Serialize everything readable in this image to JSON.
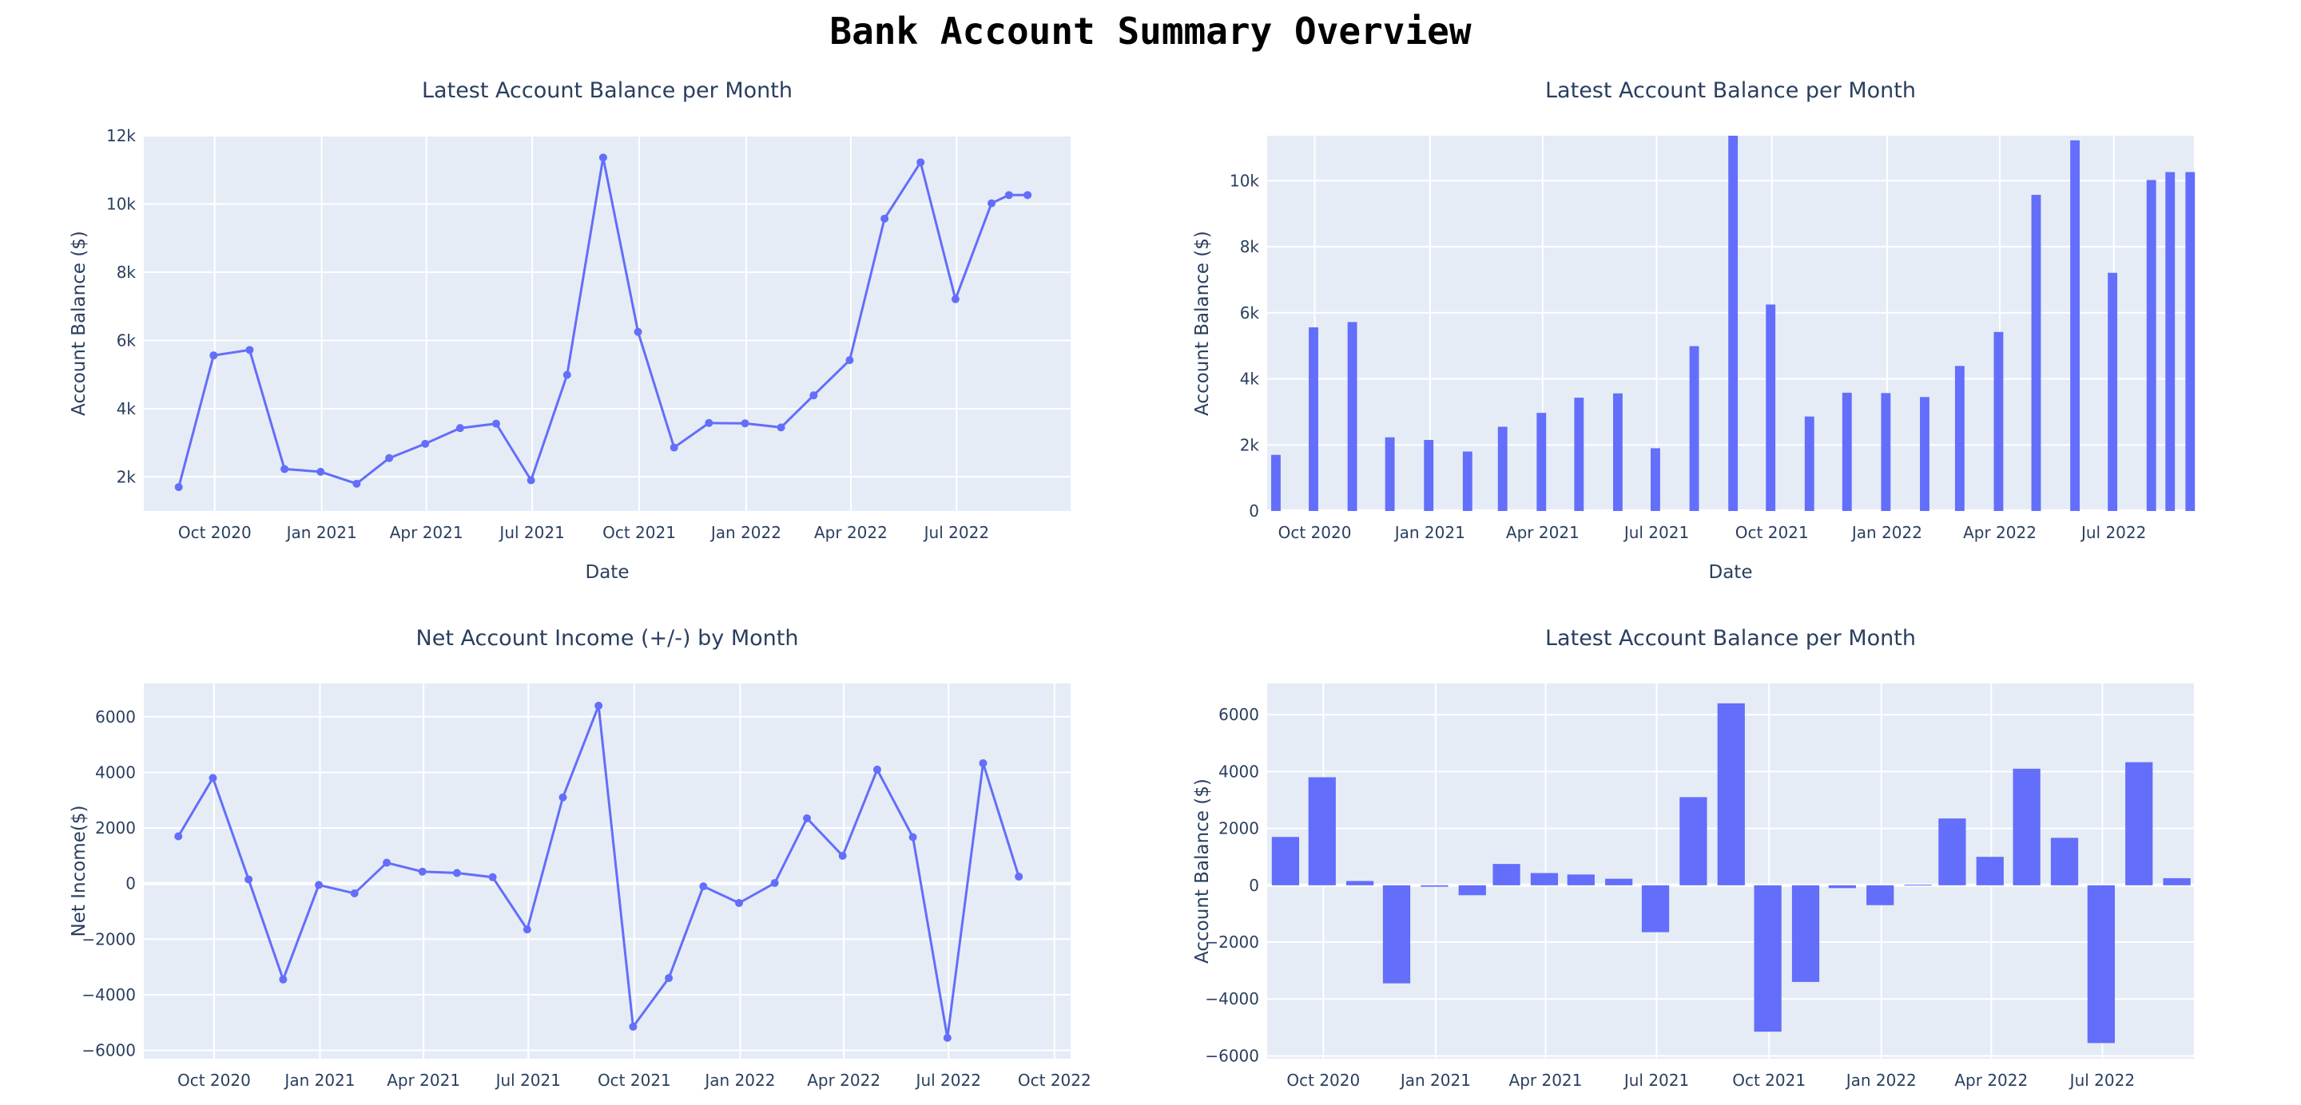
{
  "page": {
    "title": "Bank Account Summary Overview"
  },
  "colors": {
    "series": "#636efa",
    "plot_bg": "#e5ecf6",
    "grid": "#ffffff",
    "text": "#2a3f5f"
  },
  "chart_data": [
    {
      "type": "line",
      "title": "Latest Account Balance per Month",
      "xlabel": "Date",
      "ylabel": "Account Balance ($)",
      "x": [
        "2020-08-31",
        "2020-09-30",
        "2020-10-31",
        "2020-11-30",
        "2020-12-31",
        "2021-01-31",
        "2021-02-28",
        "2021-03-31",
        "2021-04-30",
        "2021-05-31",
        "2021-06-30",
        "2021-07-31",
        "2021-08-31",
        "2021-09-30",
        "2021-10-31",
        "2021-11-30",
        "2021-12-31",
        "2022-01-31",
        "2022-02-28",
        "2022-03-31",
        "2022-04-30",
        "2022-05-31",
        "2022-06-30",
        "2022-07-31",
        "2022-08-15",
        "2022-08-31"
      ],
      "values": [
        1700,
        5560,
        5720,
        2230,
        2150,
        1800,
        2550,
        2970,
        3430,
        3560,
        1900,
        4990,
        11360,
        6250,
        2860,
        3580,
        3570,
        3450,
        4390,
        5420,
        9570,
        11220,
        7210,
        10020,
        10260,
        10260
      ],
      "xlim": [
        "2020-08-01",
        "2022-10-07"
      ],
      "ylim": [
        1000,
        12000
      ],
      "yticks": [
        2000,
        4000,
        6000,
        8000,
        10000,
        12000
      ],
      "ytick_labels": [
        "2k",
        "4k",
        "6k",
        "8k",
        "10k",
        "12k"
      ],
      "xticks": [
        "2020-10-01",
        "2021-01-01",
        "2021-04-01",
        "2021-07-01",
        "2021-10-01",
        "2022-01-01",
        "2022-04-01",
        "2022-07-01"
      ],
      "xtick_labels": [
        "Oct 2020",
        "Jan 2021",
        "Apr 2021",
        "Jul 2021",
        "Oct 2021",
        "Jan 2022",
        "Apr 2022",
        "Jul 2022"
      ],
      "grid": true,
      "markers": true
    },
    {
      "type": "bar",
      "title": "Latest Account Balance per Month",
      "xlabel": "Date",
      "ylabel": "Account Balance ($)",
      "x": [
        "2020-08-31",
        "2020-09-30",
        "2020-10-31",
        "2020-11-30",
        "2020-12-31",
        "2021-01-31",
        "2021-02-28",
        "2021-03-31",
        "2021-04-30",
        "2021-05-31",
        "2021-06-30",
        "2021-07-31",
        "2021-08-31",
        "2021-09-30",
        "2021-10-31",
        "2021-11-30",
        "2021-12-31",
        "2022-01-31",
        "2022-02-28",
        "2022-03-31",
        "2022-04-30",
        "2022-05-31",
        "2022-06-30",
        "2022-07-31",
        "2022-08-15",
        "2022-08-31"
      ],
      "values": [
        1700,
        5560,
        5720,
        2230,
        2150,
        1800,
        2550,
        2970,
        3430,
        3560,
        1900,
        4990,
        11360,
        6250,
        2860,
        3580,
        3570,
        3450,
        4390,
        5420,
        9570,
        11220,
        7210,
        10020,
        10260,
        10260
      ],
      "xlim": [
        "2020-08-24",
        "2022-09-03"
      ],
      "ylim": [
        0,
        11360
      ],
      "yticks": [
        0,
        2000,
        4000,
        6000,
        8000,
        10000
      ],
      "ytick_labels": [
        "0",
        "2k",
        "4k",
        "6k",
        "8k",
        "10k"
      ],
      "xticks": [
        "2020-10-01",
        "2021-01-01",
        "2021-04-01",
        "2021-07-01",
        "2021-10-01",
        "2022-01-01",
        "2022-04-01",
        "2022-07-01"
      ],
      "xtick_labels": [
        "Oct 2020",
        "Jan 2021",
        "Apr 2021",
        "Jul 2021",
        "Oct 2021",
        "Jan 2022",
        "Apr 2022",
        "Jul 2022"
      ],
      "grid": true
    },
    {
      "type": "line",
      "title": "Net Account Income (+/-) by Month",
      "xlabel": "Date",
      "ylabel": "Net Income($)",
      "x": [
        "2020-08-31",
        "2020-09-30",
        "2020-10-31",
        "2020-11-30",
        "2020-12-31",
        "2021-01-31",
        "2021-02-28",
        "2021-03-31",
        "2021-04-30",
        "2021-05-31",
        "2021-06-30",
        "2021-07-31",
        "2021-08-31",
        "2021-09-30",
        "2021-10-31",
        "2021-11-30",
        "2021-12-31",
        "2022-01-31",
        "2022-02-28",
        "2022-03-31",
        "2022-04-30",
        "2022-05-31",
        "2022-06-30",
        "2022-07-31",
        "2022-08-31"
      ],
      "values": [
        1700,
        3800,
        150,
        -3450,
        -50,
        -350,
        750,
        430,
        380,
        230,
        -1650,
        3100,
        6400,
        -5150,
        -3400,
        -100,
        -700,
        20,
        2350,
        1000,
        4100,
        1670,
        -5550,
        4330,
        250
      ],
      "xlim": [
        "2020-08-01",
        "2022-10-15"
      ],
      "ylim": [
        -6300,
        7200
      ],
      "yticks": [
        -6000,
        -4000,
        -2000,
        0,
        2000,
        4000,
        6000
      ],
      "ytick_labels": [
        "−6000",
        "−4000",
        "−2000",
        "0",
        "2000",
        "4000",
        "6000"
      ],
      "xticks": [
        "2020-10-01",
        "2021-01-01",
        "2021-04-01",
        "2021-07-01",
        "2021-10-01",
        "2022-01-01",
        "2022-04-01",
        "2022-07-01",
        "2022-10-01"
      ],
      "xtick_labels": [
        "Oct 2020",
        "Jan 2021",
        "Apr 2021",
        "Jul 2021",
        "Oct 2021",
        "Jan 2022",
        "Apr 2022",
        "Jul 2022",
        "Oct 2022"
      ],
      "grid": true,
      "markers": true
    },
    {
      "type": "bar",
      "title": "Latest Account Balance per Month",
      "xlabel": "Date",
      "ylabel": "Account Balance ($)",
      "x": [
        "2020-08-31",
        "2020-09-30",
        "2020-10-31",
        "2020-11-30",
        "2020-12-31",
        "2021-01-31",
        "2021-02-28",
        "2021-03-31",
        "2021-04-30",
        "2021-05-31",
        "2021-06-30",
        "2021-07-31",
        "2021-08-31",
        "2021-09-30",
        "2021-10-31",
        "2021-11-30",
        "2021-12-31",
        "2022-01-31",
        "2022-02-28",
        "2022-03-31",
        "2022-04-30",
        "2022-05-31",
        "2022-06-30",
        "2022-07-31",
        "2022-08-31"
      ],
      "values": [
        1700,
        3800,
        150,
        -3450,
        -50,
        -350,
        750,
        430,
        380,
        230,
        -1650,
        3100,
        6400,
        -5150,
        -3400,
        -100,
        -700,
        20,
        2350,
        1000,
        4100,
        1670,
        -5550,
        4330,
        250
      ],
      "xlim": [
        "2020-08-16",
        "2022-09-14"
      ],
      "ylim": [
        -6100,
        7100
      ],
      "yticks": [
        -6000,
        -4000,
        -2000,
        0,
        2000,
        4000,
        6000
      ],
      "ytick_labels": [
        "−6000",
        "−4000",
        "−2000",
        "0",
        "2000",
        "4000",
        "6000"
      ],
      "xticks": [
        "2020-10-01",
        "2021-01-01",
        "2021-04-01",
        "2021-07-01",
        "2021-10-01",
        "2022-01-01",
        "2022-04-01",
        "2022-07-01"
      ],
      "xtick_labels": [
        "Oct 2020",
        "Jan 2021",
        "Apr 2021",
        "Jul 2021",
        "Oct 2021",
        "Jan 2022",
        "Apr 2022",
        "Jul 2022"
      ],
      "grid": true
    }
  ]
}
